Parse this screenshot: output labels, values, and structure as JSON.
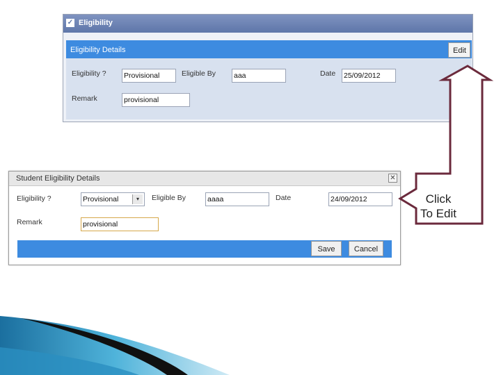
{
  "top_panel": {
    "title": "Eligibility",
    "details_title": "Eligibility Details",
    "edit_label": "Edit",
    "fields": {
      "eligibility_label": "Eligibility ?",
      "eligibility_value": "Provisional",
      "eligible_by_label": "Eligible By",
      "eligible_by_value": "aaa",
      "date_label": "Date",
      "date_value": "25/09/2012",
      "remark_label": "Remark",
      "remark_value": "provisional"
    }
  },
  "dialog": {
    "title": "Student Eligibility Details",
    "close_glyph": "✕",
    "fields": {
      "eligibility_label": "Eligibility ?",
      "eligibility_selected": "Provisional",
      "select_arrow": "▾",
      "eligible_by_label": "Eligible By",
      "eligible_by_value": "aaaa",
      "date_label": "Date",
      "date_value": "24/09/2012",
      "remark_label": "Remark",
      "remark_value": "provisional"
    },
    "save_label": "Save",
    "cancel_label": "Cancel"
  },
  "annotation": {
    "line1": "Click",
    "line2": "To Edit",
    "arrow_color": "#6b2a3c"
  },
  "colors": {
    "header_blue": "#3d8be0",
    "panel_body": "#d8e1ef",
    "titlebar": "#5e76a9"
  }
}
